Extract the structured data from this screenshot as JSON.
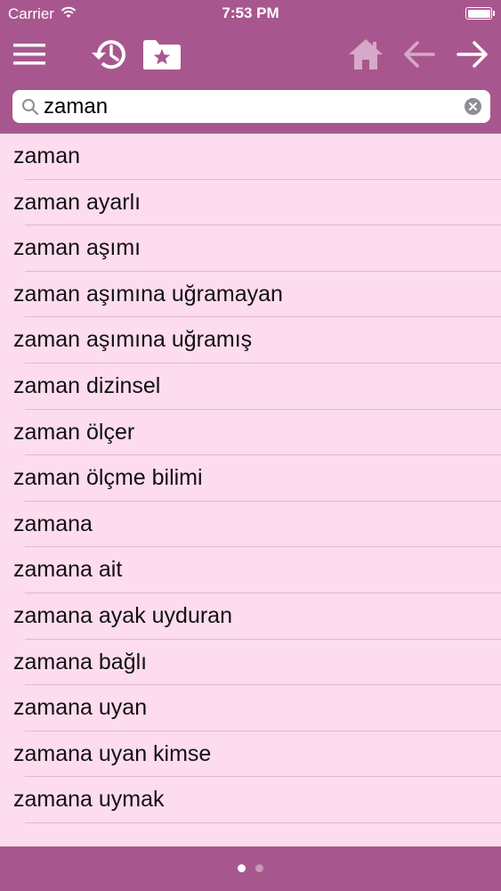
{
  "status_bar": {
    "carrier": "Carrier",
    "time": "7:53 PM"
  },
  "toolbar": {
    "icons": [
      "menu-icon",
      "history-icon",
      "favorites-folder-icon",
      "home-icon",
      "back-arrow-icon",
      "forward-arrow-icon"
    ],
    "accent_color": "#a8578e",
    "disabled_icon_color": "#d7a9c8"
  },
  "search": {
    "value": "zaman",
    "placeholder": ""
  },
  "results": [
    "zaman",
    "zaman ayarlı",
    "zaman aşımı",
    "zaman aşımına uğramayan",
    "zaman aşımına uğramış",
    "zaman dizinsel",
    "zaman ölçer",
    "zaman ölçme bilimi",
    "zamana",
    "zamana ait",
    "zamana ayak uyduran",
    "zamana bağlı",
    "zamana uyan",
    "zamana uyan kimse",
    "zamana uymak"
  ],
  "pagination": {
    "pages": 2,
    "active_page": 1
  },
  "colors": {
    "header": "#a8578e",
    "list_background": "#fcdcee",
    "separator": "#e2b9cf"
  }
}
